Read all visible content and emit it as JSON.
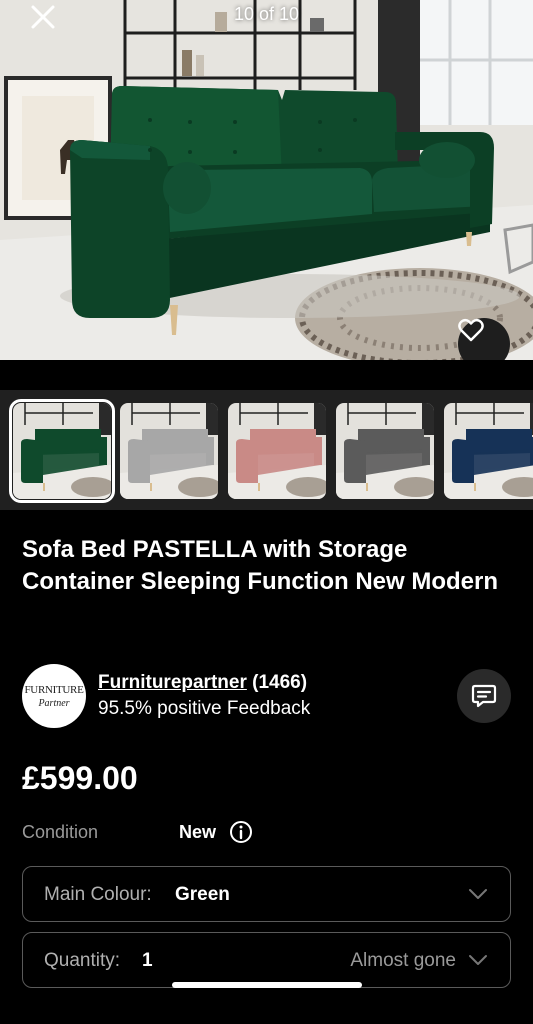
{
  "gallery": {
    "counter": "10 of 10",
    "thumbnails": [
      {
        "color_name": "green",
        "sofa_color": "#0f4a2c",
        "selected": true
      },
      {
        "color_name": "grey",
        "sofa_color": "#a7a7a7",
        "selected": false
      },
      {
        "color_name": "pink",
        "sofa_color": "#c98a86",
        "selected": false
      },
      {
        "color_name": "dark-grey",
        "sofa_color": "#5b5b5b",
        "selected": false
      },
      {
        "color_name": "navy",
        "sofa_color": "#163257",
        "selected": false
      }
    ]
  },
  "product": {
    "title": "Sofa Bed PASTELLA with Storage Container Sleeping Function New Modern",
    "price": "£599.00"
  },
  "seller": {
    "logo_line1": "FURNITURE",
    "logo_line2": "Partner",
    "name": "Furniturepartner",
    "count": "(1466)",
    "feedback": "95.5% positive Feedback"
  },
  "condition": {
    "label": "Condition",
    "value": "New"
  },
  "colour_select": {
    "label": "Main Colour:",
    "value": "Green"
  },
  "quantity_select": {
    "label": "Quantity:",
    "value": "1",
    "stock_note": "Almost gone"
  },
  "colors": {
    "background": "#000000",
    "sofa_green": "#0f4a2c",
    "thumb_strip": "#202020"
  },
  "icons": [
    "close-icon",
    "heart-icon",
    "message-icon",
    "info-icon",
    "chevron-down-icon"
  ]
}
